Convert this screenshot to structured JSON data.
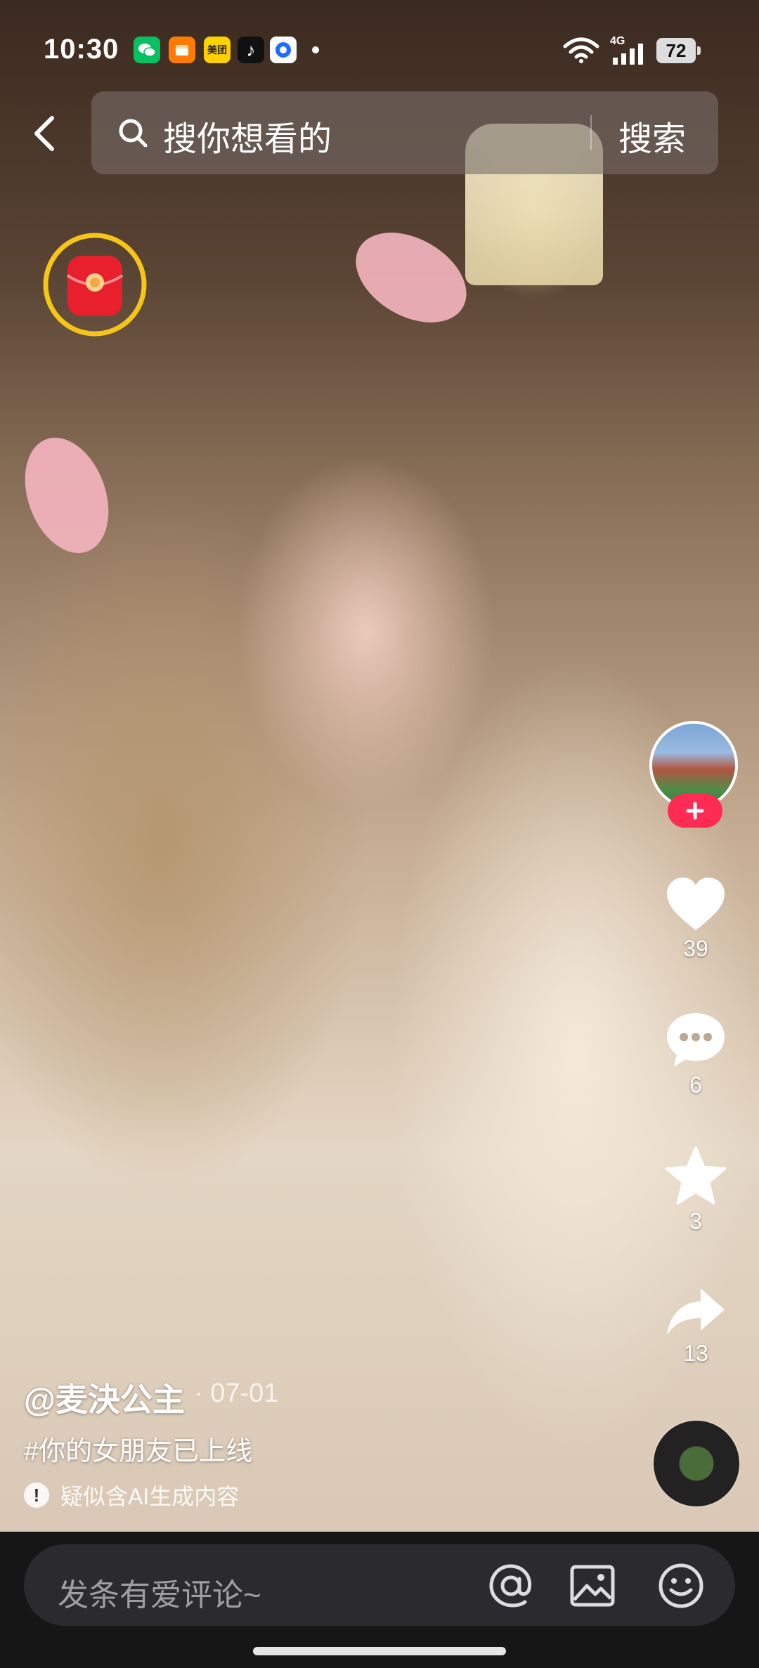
{
  "status_bar": {
    "time": "10:30",
    "apps": [
      {
        "name": "wechat-icon",
        "color": "#07c160",
        "glyph": ""
      },
      {
        "name": "calendar-app-icon",
        "color": "#ff7a00",
        "glyph": ""
      },
      {
        "name": "meituan-icon",
        "color": "#ffd100",
        "glyph": "美团"
      },
      {
        "name": "tiktok-icon",
        "color": "#111111",
        "glyph": "♪"
      },
      {
        "name": "browser-icon",
        "color": "#ffffff",
        "glyph": ""
      }
    ],
    "network": "4G",
    "battery": "72"
  },
  "search": {
    "placeholder": "搜你想看的",
    "button": "搜索"
  },
  "post": {
    "author": "@麦決公主",
    "date": "· 07-01",
    "caption": "#你的女朋友已上线",
    "ai_note": "疑似含AI生成内容"
  },
  "actions": {
    "likes": "39",
    "comments": "6",
    "favorites": "3",
    "shares": "13"
  },
  "comment_bar": {
    "placeholder": "发条有爱评论~"
  },
  "colors": {
    "accent": "#fe2c55",
    "ring": "#f5c518"
  }
}
